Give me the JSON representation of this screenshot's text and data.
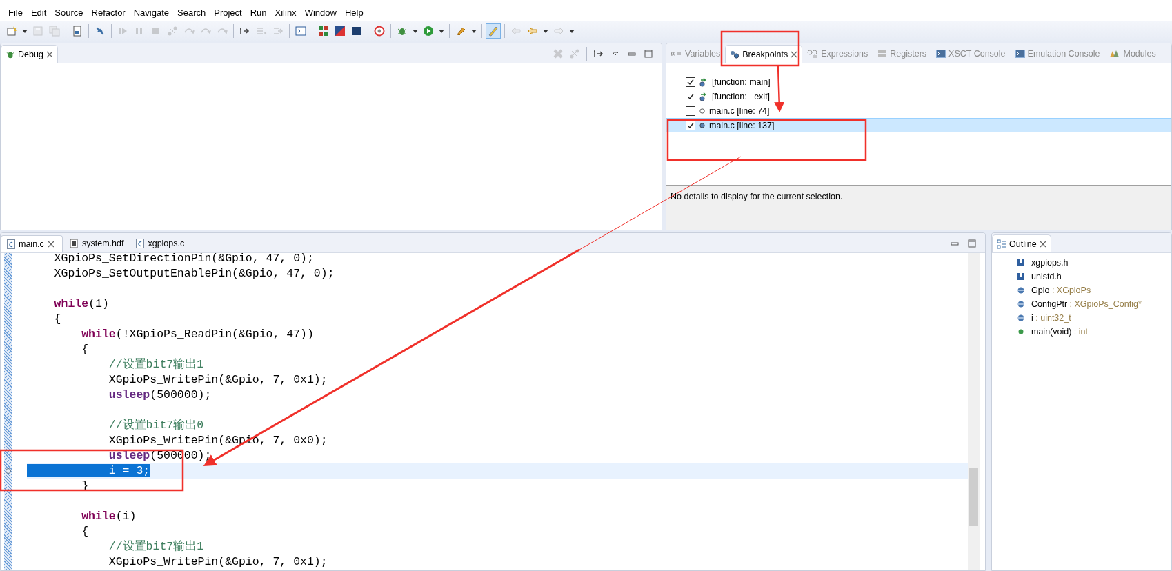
{
  "menu": [
    "File",
    "Edit",
    "Source",
    "Refactor",
    "Navigate",
    "Search",
    "Project",
    "Run",
    "Xilinx",
    "Window",
    "Help"
  ],
  "toolbar": [
    [
      {
        "kind": "new-file",
        "disabled": false,
        "pressed": false,
        "dropdown": true
      },
      {
        "kind": "save",
        "disabled": true,
        "pressed": false,
        "dropdown": false
      },
      {
        "kind": "save-all",
        "disabled": true,
        "pressed": false,
        "dropdown": false
      }
    ],
    [
      {
        "kind": "binary-file",
        "disabled": false,
        "pressed": false,
        "dropdown": false
      }
    ],
    [
      {
        "kind": "unlink",
        "disabled": false,
        "pressed": false,
        "dropdown": false
      }
    ],
    [
      {
        "kind": "resume",
        "disabled": true,
        "pressed": false,
        "dropdown": false
      },
      {
        "kind": "pause",
        "disabled": true,
        "pressed": false,
        "dropdown": false
      },
      {
        "kind": "stop",
        "disabled": true,
        "pressed": false,
        "dropdown": false
      },
      {
        "kind": "nodes",
        "disabled": true,
        "pressed": false,
        "dropdown": false
      },
      {
        "kind": "step-into",
        "disabled": true,
        "pressed": false,
        "dropdown": false
      },
      {
        "kind": "step-over",
        "disabled": true,
        "pressed": false,
        "dropdown": false
      },
      {
        "kind": "step-return",
        "disabled": true,
        "pressed": false,
        "dropdown": false
      }
    ],
    [
      {
        "kind": "instruction-step",
        "disabled": false,
        "pressed": false,
        "dropdown": false
      },
      {
        "kind": "list-arrow",
        "disabled": true,
        "pressed": false,
        "dropdown": false
      },
      {
        "kind": "branch-arrow",
        "disabled": true,
        "pressed": false,
        "dropdown": false
      }
    ],
    [
      {
        "kind": "terminal",
        "disabled": false,
        "pressed": false,
        "dropdown": false
      }
    ],
    [
      {
        "kind": "grid",
        "disabled": false,
        "pressed": false,
        "dropdown": false
      },
      {
        "kind": "gradient",
        "disabled": false,
        "pressed": false,
        "dropdown": false
      },
      {
        "kind": "console",
        "disabled": false,
        "pressed": false,
        "dropdown": false
      }
    ],
    [
      {
        "kind": "refresh",
        "disabled": false,
        "pressed": false,
        "dropdown": false
      }
    ],
    [
      {
        "kind": "bug",
        "disabled": false,
        "pressed": false,
        "dropdown": true
      },
      {
        "kind": "play",
        "disabled": false,
        "pressed": false,
        "dropdown": true
      }
    ],
    [
      {
        "kind": "pen",
        "disabled": false,
        "pressed": false,
        "dropdown": true
      }
    ],
    [
      {
        "kind": "highlighter",
        "disabled": false,
        "pressed": true,
        "dropdown": false
      }
    ],
    [
      {
        "kind": "left-arrow",
        "disabled": true,
        "pressed": false,
        "dropdown": false
      },
      {
        "kind": "left-arrow",
        "disabled": false,
        "pressed": false,
        "dropdown": true
      },
      {
        "kind": "right-arrow",
        "disabled": true,
        "pressed": false,
        "dropdown": true
      }
    ]
  ],
  "debug_view": {
    "tab": "Debug",
    "toolbar": [
      [
        {
          "kind": "remove-all",
          "disabled": true,
          "pressed": false,
          "dropdown": false
        },
        {
          "kind": "nodes",
          "disabled": true,
          "pressed": false,
          "dropdown": false
        }
      ],
      [
        {
          "kind": "instruction-step",
          "disabled": false,
          "pressed": false,
          "dropdown": false
        },
        {
          "kind": "view-menu",
          "disabled": false,
          "pressed": false,
          "dropdown": false
        },
        {
          "kind": "minimize",
          "disabled": false,
          "pressed": false,
          "dropdown": false
        },
        {
          "kind": "maximize",
          "disabled": false,
          "pressed": false,
          "dropdown": false
        }
      ]
    ]
  },
  "right_view": {
    "tabs": [
      {
        "label": "Variables",
        "kind": "variables",
        "selected": false
      },
      {
        "label": "Breakpoints",
        "kind": "breakpoints",
        "selected": true
      },
      {
        "label": "Expressions",
        "kind": "expressions",
        "selected": false
      },
      {
        "label": "Registers",
        "kind": "registers",
        "selected": false
      },
      {
        "label": "XSCT Console",
        "kind": "console",
        "selected": false
      },
      {
        "label": "Emulation Console",
        "kind": "console",
        "selected": false
      },
      {
        "label": "Modules",
        "kind": "modules",
        "selected": false
      }
    ],
    "breakpoints": [
      {
        "label": "[function: main]",
        "kind": "function",
        "checked": true,
        "selected": false
      },
      {
        "label": "[function: _exit]",
        "kind": "function",
        "checked": true,
        "selected": false
      },
      {
        "label": "main.c [line: 74]",
        "kind": "line",
        "checked": false,
        "selected": false
      },
      {
        "label": "main.c [line: 137]",
        "kind": "line",
        "checked": true,
        "selected": true
      }
    ],
    "details": "No details to display for the current selection."
  },
  "editor": {
    "tabs": [
      {
        "label": "main.c",
        "kind": "c-file",
        "selected": true
      },
      {
        "label": "system.hdf",
        "kind": "hdf-file",
        "selected": false
      },
      {
        "label": "xgpiops.c",
        "kind": "c-file",
        "selected": false
      }
    ],
    "lines": [
      {
        "kind": "code",
        "current": false,
        "selected": false,
        "breakpoint": false,
        "segments": [
          {
            "kind": "plain",
            "text": "    XGpioPs_SetDirectionPin(&Gpio, 47, 0);"
          }
        ]
      },
      {
        "kind": "code",
        "current": false,
        "selected": false,
        "breakpoint": false,
        "segments": [
          {
            "kind": "plain",
            "text": "    XGpioPs_SetOutputEnablePin(&Gpio, 47, 0);"
          }
        ]
      },
      {
        "kind": "blank",
        "current": false,
        "selected": false,
        "breakpoint": false
      },
      {
        "kind": "code",
        "current": false,
        "selected": false,
        "breakpoint": false,
        "segments": [
          {
            "kind": "keyword",
            "text": "    while"
          },
          {
            "kind": "plain",
            "text": "(1)"
          }
        ]
      },
      {
        "kind": "code",
        "current": false,
        "selected": false,
        "breakpoint": false,
        "segments": [
          {
            "kind": "plain",
            "text": "    {"
          }
        ]
      },
      {
        "kind": "code",
        "current": false,
        "selected": false,
        "breakpoint": false,
        "segments": [
          {
            "kind": "keyword",
            "text": "        while"
          },
          {
            "kind": "plain",
            "text": "(!XGpioPs_ReadPin(&Gpio, 47))"
          }
        ]
      },
      {
        "kind": "code",
        "current": false,
        "selected": false,
        "breakpoint": false,
        "segments": [
          {
            "kind": "plain",
            "text": "        {"
          }
        ]
      },
      {
        "kind": "code",
        "current": false,
        "selected": false,
        "breakpoint": false,
        "segments": [
          {
            "kind": "comment",
            "text": "            //设置bit7输出1"
          }
        ]
      },
      {
        "kind": "code",
        "current": false,
        "selected": false,
        "breakpoint": false,
        "segments": [
          {
            "kind": "plain",
            "text": "            XGpioPs_WritePin(&Gpio, 7, 0x1);"
          }
        ]
      },
      {
        "kind": "code",
        "current": false,
        "selected": false,
        "breakpoint": false,
        "segments": [
          {
            "kind": "macro",
            "text": "            usleep"
          },
          {
            "kind": "plain",
            "text": "(500000);"
          }
        ]
      },
      {
        "kind": "blank",
        "current": false,
        "selected": false,
        "breakpoint": false
      },
      {
        "kind": "code",
        "current": false,
        "selected": false,
        "breakpoint": false,
        "segments": [
          {
            "kind": "comment",
            "text": "            //设置bit7输出0"
          }
        ]
      },
      {
        "kind": "code",
        "current": false,
        "selected": false,
        "breakpoint": false,
        "segments": [
          {
            "kind": "plain",
            "text": "            XGpioPs_WritePin(&Gpio, 7, 0x0);"
          }
        ]
      },
      {
        "kind": "code",
        "current": false,
        "selected": false,
        "breakpoint": false,
        "segments": [
          {
            "kind": "macro",
            "text": "            usleep"
          },
          {
            "kind": "plain",
            "text": "(500000);"
          }
        ]
      },
      {
        "kind": "code",
        "current": true,
        "selected": true,
        "breakpoint": true,
        "segments": [
          {
            "kind": "plain",
            "text": "            i = 3;"
          }
        ]
      },
      {
        "kind": "code",
        "current": false,
        "selected": false,
        "breakpoint": false,
        "segments": [
          {
            "kind": "plain",
            "text": "        }"
          }
        ]
      },
      {
        "kind": "blank",
        "current": false,
        "selected": false,
        "breakpoint": false
      },
      {
        "kind": "code",
        "current": false,
        "selected": false,
        "breakpoint": false,
        "segments": [
          {
            "kind": "keyword",
            "text": "        while"
          },
          {
            "kind": "plain",
            "text": "(i)"
          }
        ]
      },
      {
        "kind": "code",
        "current": false,
        "selected": false,
        "breakpoint": false,
        "segments": [
          {
            "kind": "plain",
            "text": "        {"
          }
        ]
      },
      {
        "kind": "code",
        "current": false,
        "selected": false,
        "breakpoint": false,
        "segments": [
          {
            "kind": "comment",
            "text": "            //设置bit7输出1"
          }
        ]
      },
      {
        "kind": "code",
        "current": false,
        "selected": false,
        "breakpoint": false,
        "segments": [
          {
            "kind": "plain",
            "text": "            XGpioPs_WritePin(&Gpio, 7, 0x1);"
          }
        ]
      }
    ]
  },
  "outline": {
    "title": "Outline",
    "items": [
      {
        "kind": "include",
        "name": "xgpiops.h"
      },
      {
        "kind": "include",
        "name": "unistd.h"
      },
      {
        "kind": "field",
        "name": "Gpio",
        "type": ": XGpioPs"
      },
      {
        "kind": "field",
        "name": "ConfigPtr",
        "type": ": XGpioPs_Config*"
      },
      {
        "kind": "field",
        "name": "i",
        "type": ": uint32_t"
      },
      {
        "kind": "function",
        "name": "main(void)",
        "type": ": int"
      }
    ]
  }
}
